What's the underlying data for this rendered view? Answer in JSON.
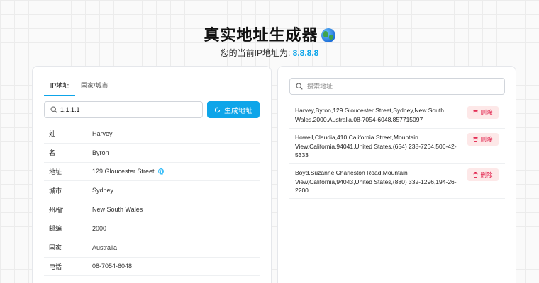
{
  "header": {
    "title": "真实地址生成器",
    "subtitle_prefix": "您的当前IP地址为: ",
    "current_ip": "8.8.8.8"
  },
  "tabs": [
    {
      "label": "IP地址",
      "active": true
    },
    {
      "label": "国家/城市",
      "active": false
    }
  ],
  "ip_input": {
    "value": "1.1.1.1"
  },
  "generate_button": {
    "label": "生成地址"
  },
  "details": [
    {
      "key": "姓",
      "value": "Harvey"
    },
    {
      "key": "名",
      "value": "Byron"
    },
    {
      "key": "地址",
      "value": "129 Gloucester Street"
    },
    {
      "key": "城市",
      "value": "Sydney"
    },
    {
      "key": "州/省",
      "value": "New South Wales"
    },
    {
      "key": "邮编",
      "value": "2000"
    },
    {
      "key": "国家",
      "value": "Australia"
    },
    {
      "key": "电话",
      "value": "08-7054-6048"
    }
  ],
  "history_search": {
    "placeholder": "搜索地址"
  },
  "history": [
    {
      "text": "Harvey,Byron,129 Gloucester Street,Sydney,New South Wales,2000,Australia,08-7054-6048,857715097",
      "delete_label": "删除"
    },
    {
      "text": "Howell,Claudia,410 California Street,Mountain View,California,94041,United States,(654) 238-7264,506-42-5333",
      "delete_label": "删除"
    },
    {
      "text": "Boyd,Suzanne,Charleston Road,Mountain View,California,94043,United States,(880) 332-1296,194-26-2200",
      "delete_label": "删除"
    }
  ],
  "colors": {
    "accent": "#0ea5e9",
    "danger": "#e11d48",
    "danger_bg": "#fde8e8"
  }
}
